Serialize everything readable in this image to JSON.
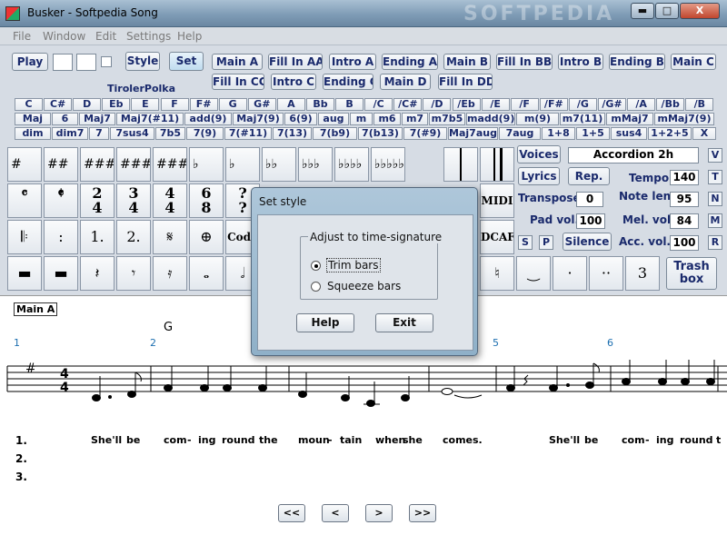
{
  "window": {
    "title": "Busker - Softpedia Song",
    "watermark": "SOFTPEDIA",
    "minimize": "▬",
    "maximize": "□",
    "close": "X"
  },
  "menu": [
    "File",
    "Window",
    "Edit",
    "Settings",
    "Help"
  ],
  "toolbar": {
    "play": "Play",
    "style": "Style",
    "set": "Set",
    "style_name": "TirolerPolka"
  },
  "sections_row1": [
    "Main A",
    "Fill In AA",
    "Intro A",
    "Ending A",
    "Main B",
    "Fill In BB",
    "Intro B",
    "Ending B",
    "Main C"
  ],
  "sections_row2": [
    "Fill In CC",
    "Intro C",
    "Ending C",
    "Main D",
    "Fill In DD"
  ],
  "chord_roots": [
    "C",
    "C#",
    "D",
    "Eb",
    "E",
    "F",
    "F#",
    "G",
    "G#",
    "A",
    "Bb",
    "B",
    "/C",
    "/C#",
    "/D",
    "/Eb",
    "/E",
    "/F",
    "/F#",
    "/G",
    "/G#",
    "/A",
    "/Bb",
    "/B"
  ],
  "chord_types_1": [
    "Maj",
    "6",
    "Maj7",
    "Maj7(#11)",
    "add(9)",
    "Maj7(9)",
    "6(9)",
    "aug",
    "m",
    "m6",
    "m7",
    "m7b5",
    "madd(9)",
    "m(9)",
    "m7(11)",
    "mMaj7",
    "mMaj7(9)"
  ],
  "chord_types_2": [
    "dim",
    "dim7",
    "7",
    "7sus4",
    "7b5",
    "7(9)",
    "7(#11)",
    "7(13)",
    "7(b9)",
    "7(b13)",
    "7(#9)",
    "Maj7aug",
    "7aug",
    "1+8",
    "1+5",
    "sus4",
    "1+2+5",
    "X"
  ],
  "key_sigs": [
    "#",
    "##",
    "###",
    "####",
    "#####",
    "♭",
    "♭",
    "♭♭",
    "♭♭♭",
    "♭♭♭♭",
    "♭♭♭♭♭"
  ],
  "time_sigs": [
    "𝄴",
    "𝄵",
    "2\n4",
    "3\n4",
    "4\n4",
    "6\n8",
    "?\n?"
  ],
  "misc_syms_left": [
    "𝄆",
    ":",
    "1.",
    "2.",
    "𝄋",
    "⊕"
  ],
  "coda": "Coda",
  "midi": "MIDI",
  "dcaf": "DCAF",
  "rests": [
    "▬",
    "▬",
    "𝄽",
    "𝄾",
    "𝄿",
    "𝅝",
    "𝅗𝅥"
  ],
  "misc_syms_right": [
    "♮",
    "‿",
    "·",
    "··",
    "3"
  ],
  "right_panel": {
    "voices": "Voices",
    "voice_name": "Accordion 2h",
    "lyrics": "Lyrics",
    "rep": "Rep.",
    "tempo_label": "Tempo",
    "tempo": "140",
    "transpose_label": "Transpose",
    "transpose": "0",
    "note_len_label": "Note len.",
    "note_len": "95",
    "pad_vol_label": "Pad vol.",
    "pad_vol": "100",
    "mel_vol_label": "Mel. vol.",
    "mel_vol": "84",
    "s": "S",
    "p": "P",
    "silence": "Silence",
    "acc_vol_label": "Acc. vol.",
    "acc_vol": "100",
    "trash": "Trash box",
    "side": [
      "V",
      "T",
      "N",
      "M",
      "R"
    ]
  },
  "score": {
    "section": "Main A",
    "chord": "G",
    "bar_numbers": [
      "1",
      "2",
      "5",
      "6"
    ],
    "time_sig": [
      "4",
      "4"
    ],
    "key_sig": "#",
    "verse_numbers": [
      "1.",
      "2.",
      "3."
    ],
    "lyrics": [
      "She'll",
      "be",
      "com",
      "-",
      "ing",
      "round",
      "the",
      "moun",
      "-",
      "tain",
      "when",
      "she",
      "comes.",
      "She'll",
      "be",
      "com",
      "-",
      "ing",
      "round",
      "t"
    ],
    "nav": [
      "<<",
      "<",
      ">",
      ">>"
    ]
  },
  "dialog": {
    "title": "Set style",
    "group": "Adjust to time-signature",
    "options": [
      "Trim bars",
      "Squeeze bars"
    ],
    "selected": 0,
    "help": "Help",
    "exit": "Exit"
  }
}
